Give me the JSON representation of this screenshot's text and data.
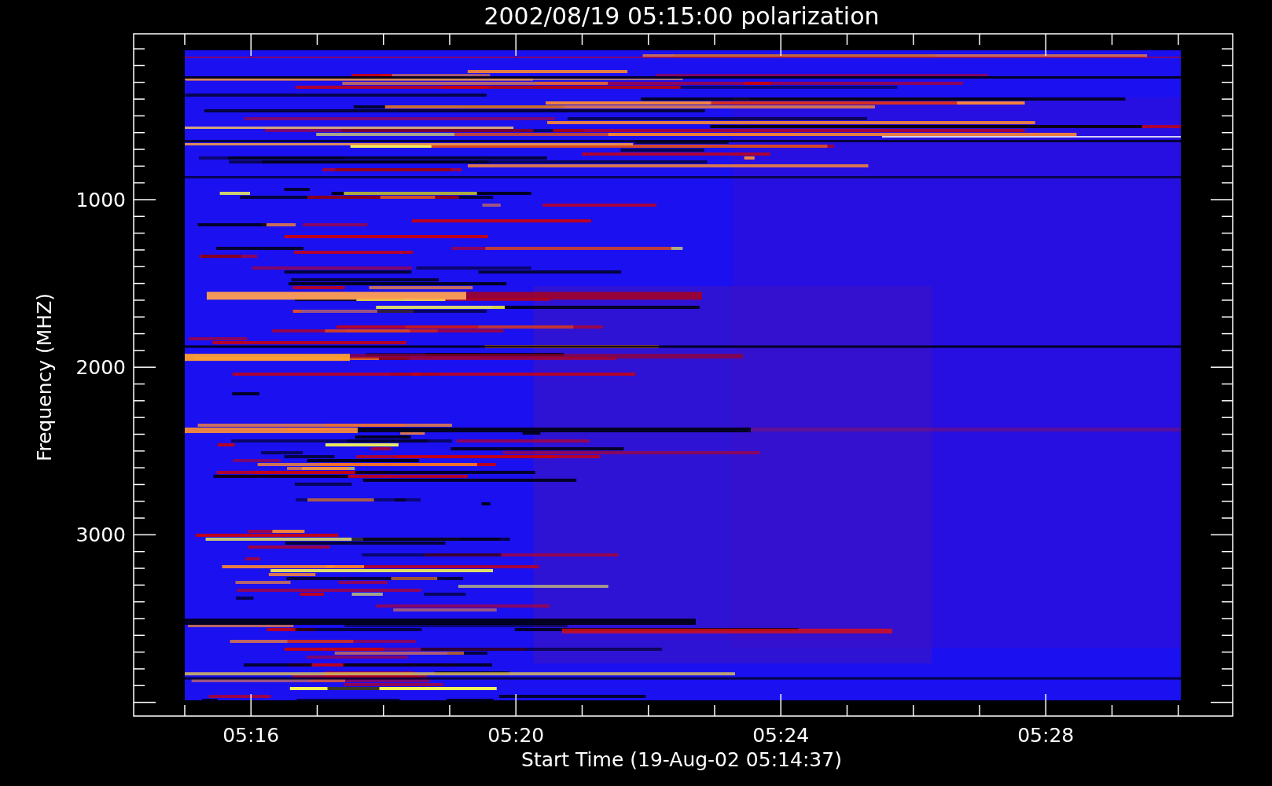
{
  "plot": {
    "title": "2002/08/19 05:15:00 polarization",
    "x_axis": {
      "label": "Start Time (19-Aug-02 05:14:37)",
      "ticks": [
        "05:16",
        "05:20",
        "05:24",
        "05:28"
      ]
    },
    "y_axis": {
      "label": "Frequency (MHZ)",
      "ticks": [
        "1000",
        "2000",
        "3000"
      ]
    }
  }
}
